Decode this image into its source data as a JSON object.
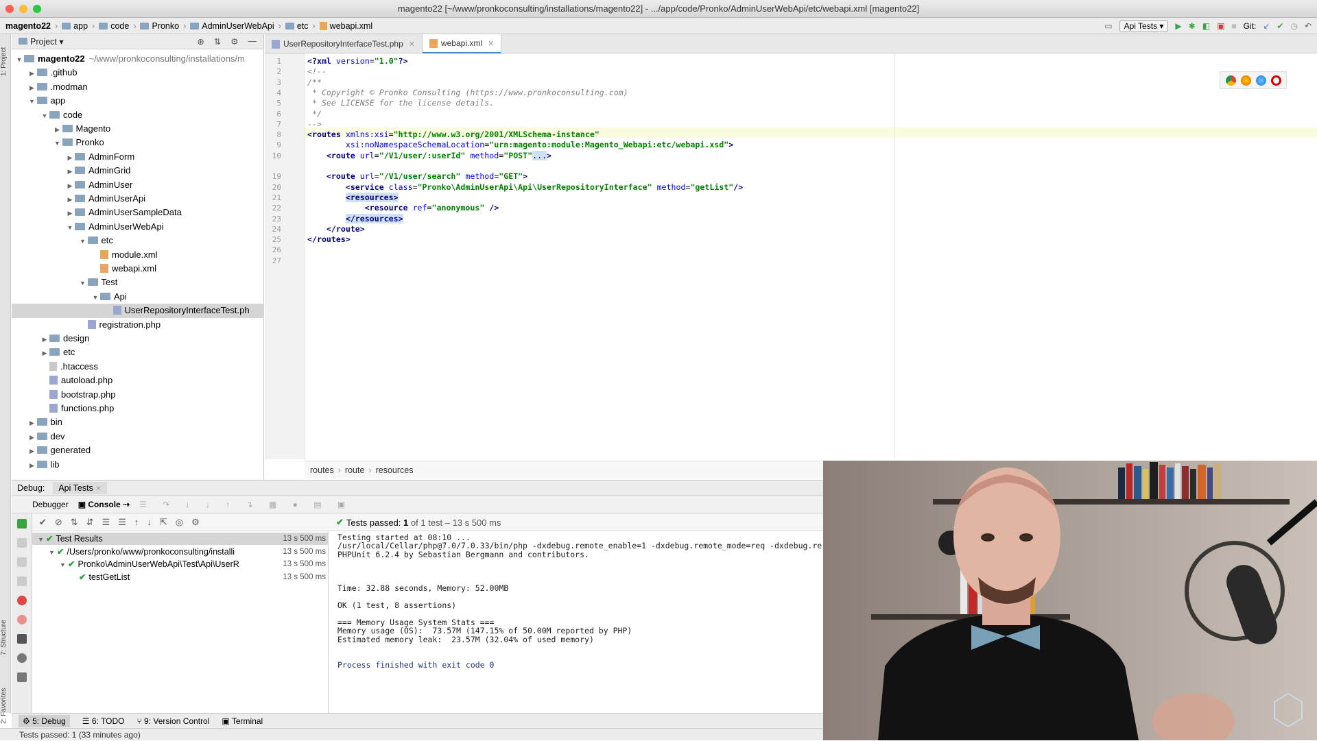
{
  "window": {
    "title": "magento22 [~/www/pronkoconsulting/installations/magento22] - .../app/code/Pronko/AdminUserWebApi/etc/webapi.xml [magento22]"
  },
  "navbar": {
    "crumbs": [
      "magento22",
      "app",
      "code",
      "Pronko",
      "AdminUserWebApi",
      "etc",
      "webapi.xml"
    ],
    "run_config": "Api Tests",
    "git_label": "Git:"
  },
  "project": {
    "header": "Project",
    "tree": [
      {
        "label": "magento22",
        "path": "~/www/pronkoconsulting/installations/m",
        "type": "folder",
        "depth": 0,
        "open": true
      },
      {
        "label": ".github",
        "type": "folder",
        "depth": 1,
        "open": false
      },
      {
        "label": ".modman",
        "type": "folder",
        "depth": 1,
        "open": false
      },
      {
        "label": "app",
        "type": "folder",
        "depth": 1,
        "open": true
      },
      {
        "label": "code",
        "type": "folder",
        "depth": 2,
        "open": true
      },
      {
        "label": "Magento",
        "type": "folder",
        "depth": 3,
        "open": false
      },
      {
        "label": "Pronko",
        "type": "folder",
        "depth": 3,
        "open": true
      },
      {
        "label": "AdminForm",
        "type": "folder",
        "depth": 4,
        "open": false
      },
      {
        "label": "AdminGrid",
        "type": "folder",
        "depth": 4,
        "open": false
      },
      {
        "label": "AdminUser",
        "type": "folder",
        "depth": 4,
        "open": false
      },
      {
        "label": "AdminUserApi",
        "type": "folder",
        "depth": 4,
        "open": false
      },
      {
        "label": "AdminUserSampleData",
        "type": "folder",
        "depth": 4,
        "open": false
      },
      {
        "label": "AdminUserWebApi",
        "type": "folder",
        "depth": 4,
        "open": true
      },
      {
        "label": "etc",
        "type": "folder",
        "depth": 5,
        "open": true
      },
      {
        "label": "module.xml",
        "type": "xml",
        "depth": 6
      },
      {
        "label": "webapi.xml",
        "type": "xml",
        "depth": 6
      },
      {
        "label": "Test",
        "type": "folder",
        "depth": 5,
        "open": true
      },
      {
        "label": "Api",
        "type": "folder",
        "depth": 6,
        "open": true
      },
      {
        "label": "UserRepositoryInterfaceTest.ph",
        "type": "php",
        "depth": 7,
        "selected": true
      },
      {
        "label": "registration.php",
        "type": "php",
        "depth": 5
      },
      {
        "label": "design",
        "type": "folder",
        "depth": 2,
        "open": false
      },
      {
        "label": "etc",
        "type": "folder",
        "depth": 2,
        "open": false
      },
      {
        "label": ".htaccess",
        "type": "file",
        "depth": 2
      },
      {
        "label": "autoload.php",
        "type": "php",
        "depth": 2
      },
      {
        "label": "bootstrap.php",
        "type": "php",
        "depth": 2
      },
      {
        "label": "functions.php",
        "type": "php",
        "depth": 2
      },
      {
        "label": "bin",
        "type": "folder",
        "depth": 1,
        "open": false
      },
      {
        "label": "dev",
        "type": "folder",
        "depth": 1,
        "open": false
      },
      {
        "label": "generated",
        "type": "folder",
        "depth": 1,
        "open": false
      },
      {
        "label": "lib",
        "type": "folder",
        "depth": 1,
        "open": false
      }
    ]
  },
  "editor": {
    "tabs": [
      {
        "label": "UserRepositoryInterfaceTest.php",
        "active": false
      },
      {
        "label": "webapi.xml",
        "active": true
      }
    ],
    "line_numbers": [
      "1",
      "2",
      "3",
      "4",
      "5",
      "6",
      "7",
      "8",
      "9",
      "10",
      "19",
      "20",
      "21",
      "22",
      "23",
      "24",
      "25",
      "26",
      "27"
    ],
    "breadcrumb": [
      "routes",
      "route",
      "resources"
    ]
  },
  "debug": {
    "label": "Debug:",
    "config_tab": "Api Tests",
    "tabs": [
      "Debugger",
      "Console"
    ],
    "passed_label": "Tests passed:",
    "passed_count": "1",
    "passed_detail": "of 1 test – 13 s 500 ms",
    "tests": [
      {
        "label": "Test Results",
        "time": "13 s 500 ms",
        "depth": 0
      },
      {
        "label": "/Users/pronko/www/pronkoconsulting/installi",
        "time": "13 s 500 ms",
        "depth": 1
      },
      {
        "label": "Pronko\\AdminUserWebApi\\Test\\Api\\UserR",
        "time": "13 s 500 ms",
        "depth": 2
      },
      {
        "label": "testGetList",
        "time": "13 s 500 ms",
        "depth": 3
      }
    ],
    "console": [
      "Testing started at 08:10 ...",
      "/usr/local/Cellar/php@7.0/7.0.33/bin/php -dxdebug.remote_enable=1 -dxdebug.remote_mode=req -dxdebug.re",
      "PHPUnit 6.2.4 by Sebastian Bergmann and contributors.",
      "",
      "",
      "",
      "Time: 32.88 seconds, Memory: 52.00MB",
      "",
      "OK (1 test, 8 assertions)",
      "",
      "=== Memory Usage System Stats ===",
      "Memory usage (OS):  73.57M (147.15% of 50.00M reported by PHP)",
      "Estimated memory leak:  23.57M (32.04% of used memory)",
      "",
      "",
      "Process finished with exit code 0"
    ]
  },
  "bottom_tabs": [
    "5: Debug",
    "6: TODO",
    "9: Version Control",
    "Terminal"
  ],
  "status": "Tests passed: 1 (33 minutes ago)",
  "side_tabs": [
    "1: Project",
    "7: Structure",
    "2: Favorites"
  ]
}
